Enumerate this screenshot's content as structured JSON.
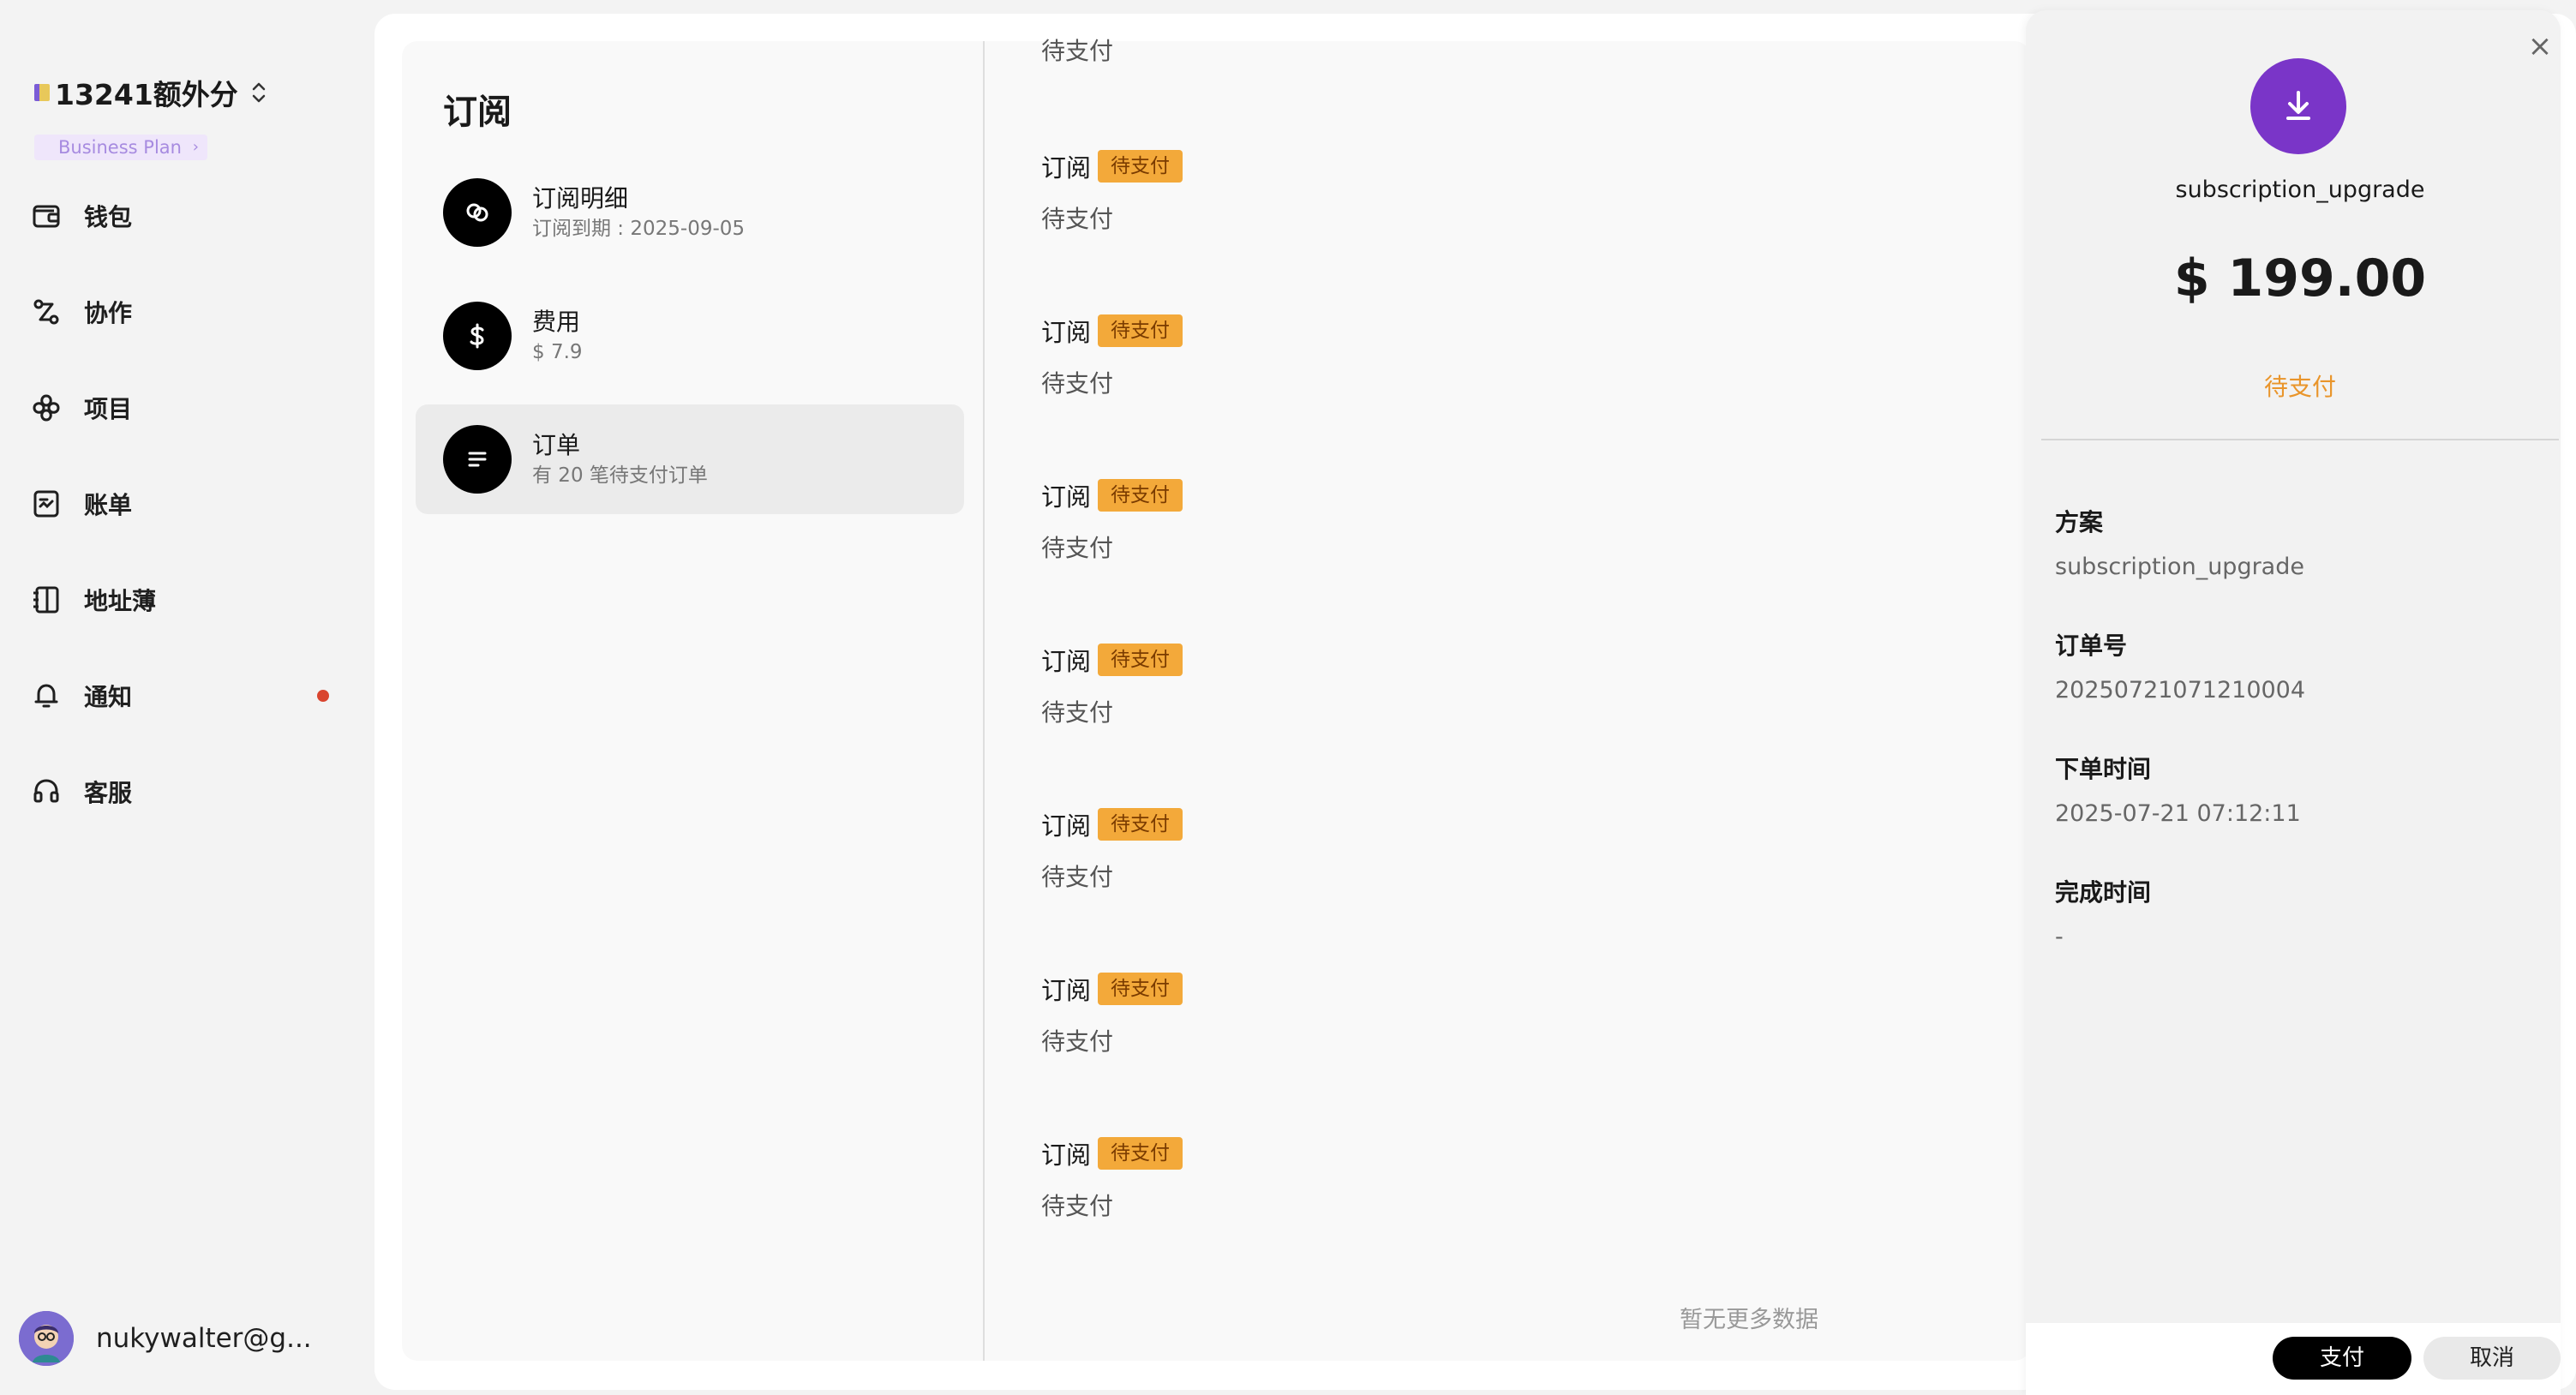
{
  "sidebar": {
    "workspace_name": "13241额外分",
    "plan_label": "Business Plan",
    "items": [
      {
        "label": "钱包"
      },
      {
        "label": "协作"
      },
      {
        "label": "项目"
      },
      {
        "label": "账单"
      },
      {
        "label": "地址薄"
      },
      {
        "label": "通知"
      },
      {
        "label": "客服"
      }
    ],
    "user_email": "nukywalter@g..."
  },
  "menu": {
    "title": "订阅",
    "items": [
      {
        "title": "订阅明细",
        "subtitle": "订阅到期 : 2025-09-05"
      },
      {
        "title": "费用",
        "subtitle": "$ 7.9"
      },
      {
        "title": "订单",
        "subtitle": "有 20 笔待支付订单"
      }
    ]
  },
  "orders": {
    "partial_status": "待支付",
    "items": [
      {
        "type": "订阅",
        "tag": "待支付",
        "status": "待支付"
      },
      {
        "type": "订阅",
        "tag": "待支付",
        "status": "待支付"
      },
      {
        "type": "订阅",
        "tag": "待支付",
        "status": "待支付"
      },
      {
        "type": "订阅",
        "tag": "待支付",
        "status": "待支付"
      },
      {
        "type": "订阅",
        "tag": "待支付",
        "status": "待支付"
      },
      {
        "type": "订阅",
        "tag": "待支付",
        "status": "待支付"
      },
      {
        "type": "订阅",
        "tag": "待支付",
        "status": "待支付"
      }
    ],
    "no_more": "暂无更多数据"
  },
  "drawer": {
    "name": "subscription_upgrade",
    "amount": "$ 199.00",
    "status": "待支付",
    "fields": [
      {
        "label": "方案",
        "value": "subscription_upgrade"
      },
      {
        "label": "订单号",
        "value": "20250721071210004"
      },
      {
        "label": "下单时间",
        "value": "2025-07-21 07:12:11"
      },
      {
        "label": "完成时间",
        "value": "-"
      }
    ],
    "pay_label": "支付",
    "cancel_label": "取消"
  },
  "colors": {
    "accent": "#7a35c8",
    "pending_tag": "#f3a93a",
    "pending_text": "#e9952b",
    "notification_dot": "#d9442e"
  }
}
